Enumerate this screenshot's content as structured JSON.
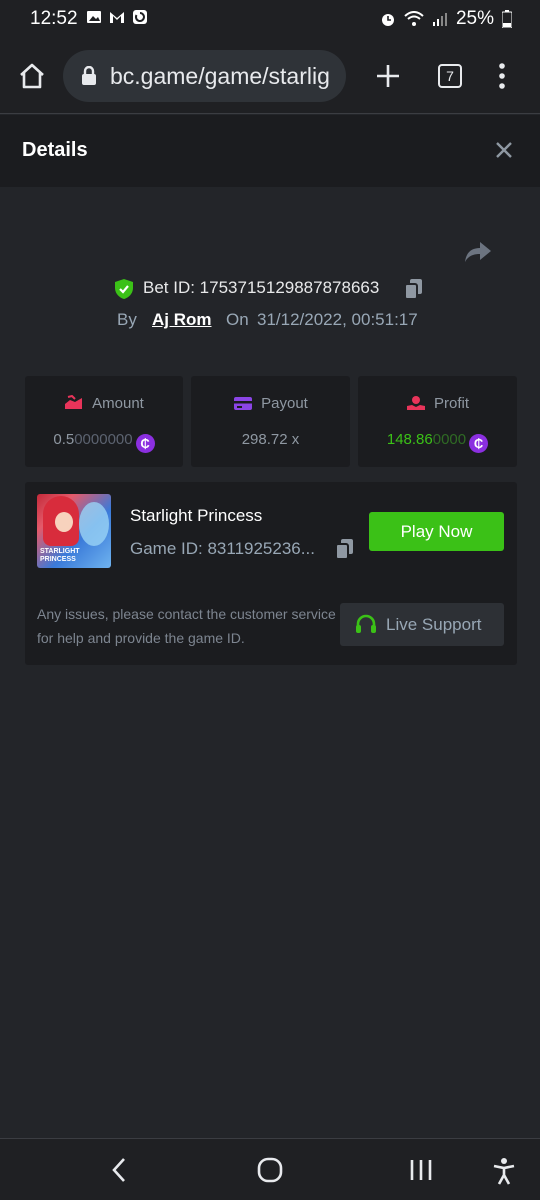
{
  "status_bar": {
    "time": "12:52",
    "battery": "25%"
  },
  "browser": {
    "url": "bc.game/game/starlig",
    "tab_count": "7"
  },
  "header": {
    "title": "Details"
  },
  "bet": {
    "bet_id_label": "Bet ID: 1753715129887878663",
    "by_label": "By",
    "user": "Aj Rom",
    "on_label": "On",
    "date": "31/12/2022, 00:51:17"
  },
  "stats": {
    "amount_label": "Amount",
    "amount_value_main": "0.5",
    "amount_value_dim": "0000000",
    "payout_label": "Payout",
    "payout_value": "298.72 x",
    "profit_label": "Profit",
    "profit_value_main": "148.86",
    "profit_value_dim": "0000",
    "coin_symbol": "₵"
  },
  "game": {
    "name": "Starlight Princess",
    "game_id": "Game ID: 8311925236...",
    "play_label": "Play Now",
    "issue_text": "Any issues, please contact the customer service for help and provide the game ID.",
    "support_label": "Live Support",
    "thumb_logo_line1": "STARLIGHT",
    "thumb_logo_line2": "PRINCESS"
  },
  "colors": {
    "accent_green": "#3bc117",
    "coin_purple": "#8b2fe0",
    "background": "#232529",
    "card": "#1b1c1f"
  }
}
